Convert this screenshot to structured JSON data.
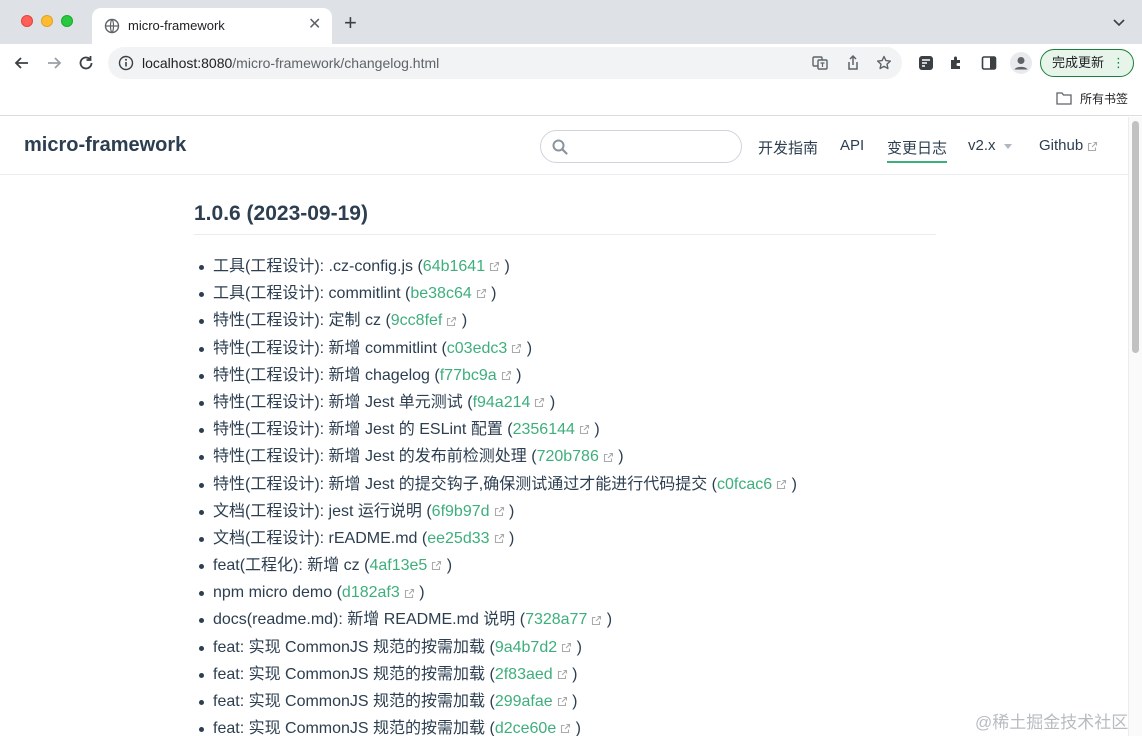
{
  "browser": {
    "tab_title": "micro-framework",
    "url_host": "localhost:8080",
    "url_path": "/micro-framework/changelog.html",
    "update_button": "完成更新",
    "bookmark_folder": "所有书签"
  },
  "site": {
    "title": "micro-framework",
    "search_placeholder": "",
    "nav": {
      "guide": "开发指南",
      "api": "API",
      "changelog": "变更日志",
      "version": "v2.x",
      "github": "Github"
    }
  },
  "page": {
    "version_heading": "1.0.6 (2023-09-19)",
    "entries": [
      {
        "text": "工具(工程设计): .cz-config.js (",
        "hash": "64b1641",
        "tail": " )"
      },
      {
        "text": "工具(工程设计): commitlint (",
        "hash": "be38c64",
        "tail": " )"
      },
      {
        "text": "特性(工程设计): 定制 cz (",
        "hash": "9cc8fef",
        "tail": " )"
      },
      {
        "text": "特性(工程设计): 新增 commitlint (",
        "hash": "c03edc3",
        "tail": " )"
      },
      {
        "text": "特性(工程设计): 新增 chagelog (",
        "hash": "f77bc9a",
        "tail": " )"
      },
      {
        "text": "特性(工程设计): 新增 Jest 单元测试 (",
        "hash": "f94a214",
        "tail": " )"
      },
      {
        "text": "特性(工程设计): 新增 Jest 的 ESLint 配置 (",
        "hash": "2356144",
        "tail": " )"
      },
      {
        "text": "特性(工程设计): 新增 Jest 的发布前检测处理 (",
        "hash": "720b786",
        "tail": " )"
      },
      {
        "text": "特性(工程设计): 新增 Jest 的提交钩子,确保测试通过才能进行代码提交 (",
        "hash": "c0fcac6",
        "tail": " )"
      },
      {
        "text": "文档(工程设计): jest 运行说明 (",
        "hash": "6f9b97d",
        "tail": " )"
      },
      {
        "text": "文档(工程设计): rEADME.md (",
        "hash": "ee25d33",
        "tail": " )"
      },
      {
        "text": "feat(工程化): 新增 cz (",
        "hash": "4af13e5",
        "tail": " )"
      },
      {
        "text": "npm micro demo (",
        "hash": "d182af3",
        "tail": " )"
      },
      {
        "text": "docs(readme.md): 新增 README.md 说明 (",
        "hash": "7328a77",
        "tail": " )"
      },
      {
        "text": "feat: 实现 CommonJS 规范的按需加载 (",
        "hash": "9a4b7d2",
        "tail": " )"
      },
      {
        "text": "feat: 实现 CommonJS 规范的按需加载 (",
        "hash": "2f83aed",
        "tail": " )"
      },
      {
        "text": "feat: 实现 CommonJS 规范的按需加载 (",
        "hash": "299afae",
        "tail": " )"
      },
      {
        "text": "feat: 实现 CommonJS 规范的按需加载 (",
        "hash": "d2ce60e",
        "tail": " )"
      }
    ]
  },
  "watermark": "@稀土掘金技术社区"
}
